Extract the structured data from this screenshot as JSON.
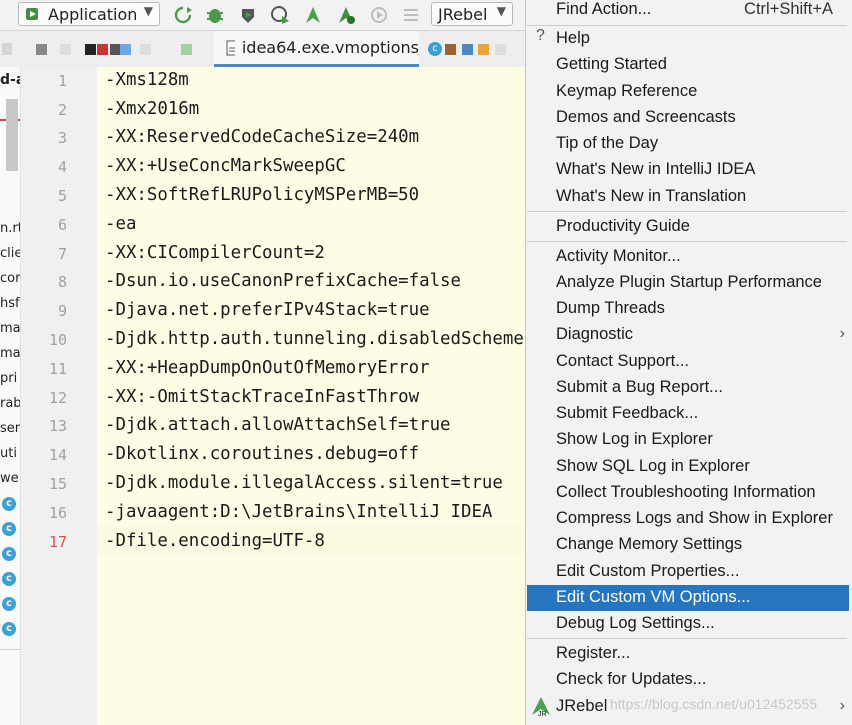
{
  "toolbar": {
    "run_config": "Application",
    "plugin": "JRebel"
  },
  "tabs": {
    "active": "idea64.exe.vmoptions"
  },
  "left_panel": {
    "fragments": [
      "d-a",
      "n.rt",
      "clie",
      "cor",
      "hsf",
      "ma",
      "ma",
      "pri",
      "rab",
      "ser",
      "uti",
      "we"
    ],
    "badge": "c"
  },
  "editor": {
    "lines": [
      {
        "num": "1",
        "text": "-Xms128m"
      },
      {
        "num": "2",
        "text": "-Xmx2016m"
      },
      {
        "num": "3",
        "text": "-XX:ReservedCodeCacheSize=240m"
      },
      {
        "num": "4",
        "text": "-XX:+UseConcMarkSweepGC"
      },
      {
        "num": "5",
        "text": "-XX:SoftRefLRUPolicyMSPerMB=50"
      },
      {
        "num": "6",
        "text": "-ea"
      },
      {
        "num": "7",
        "text": "-XX:CICompilerCount=2"
      },
      {
        "num": "8",
        "text": "-Dsun.io.useCanonPrefixCache=false"
      },
      {
        "num": "9",
        "text": "-Djava.net.preferIPv4Stack=true"
      },
      {
        "num": "10",
        "text": "-Djdk.http.auth.tunneling.disabledSchemes=\"\""
      },
      {
        "num": "11",
        "text": "-XX:+HeapDumpOnOutOfMemoryError"
      },
      {
        "num": "12",
        "text": "-XX:-OmitStackTraceInFastThrow"
      },
      {
        "num": "13",
        "text": "-Djdk.attach.allowAttachSelf=true"
      },
      {
        "num": "14",
        "text": "-Dkotlinx.coroutines.debug=off"
      },
      {
        "num": "15",
        "text": "-Djdk.module.illegalAccess.silent=true"
      },
      {
        "num": "16",
        "text": "-javaagent:D:\\JetBrains\\IntelliJ IDEA"
      },
      {
        "num": "17",
        "text": "-Dfile.encoding=UTF-8"
      }
    ]
  },
  "menu": {
    "items": [
      {
        "label": "Find Action...",
        "shortcut": "Ctrl+Shift+A"
      },
      {
        "label": "Help"
      },
      {
        "label": "Getting Started"
      },
      {
        "label": "Keymap Reference"
      },
      {
        "label": "Demos and Screencasts"
      },
      {
        "label": "Tip of the Day"
      },
      {
        "label": "What's New in IntelliJ IDEA"
      },
      {
        "label": "What's New in Translation"
      },
      {
        "label": "Productivity Guide"
      },
      {
        "label": "Activity Monitor..."
      },
      {
        "label": "Analyze Plugin Startup Performance"
      },
      {
        "label": "Dump Threads"
      },
      {
        "label": "Diagnostic"
      },
      {
        "label": "Contact Support..."
      },
      {
        "label": "Submit a Bug Report..."
      },
      {
        "label": "Submit Feedback..."
      },
      {
        "label": "Show Log in Explorer"
      },
      {
        "label": "Show SQL Log in Explorer"
      },
      {
        "label": "Collect Troubleshooting Information"
      },
      {
        "label": "Compress Logs and Show in Explorer"
      },
      {
        "label": "Change Memory Settings"
      },
      {
        "label": "Edit Custom Properties..."
      },
      {
        "label": "Edit Custom VM Options...",
        "selected": true
      },
      {
        "label": "Debug Log Settings..."
      },
      {
        "label": "Register..."
      },
      {
        "label": "Check for Updates..."
      },
      {
        "label": "JRebel"
      }
    ]
  },
  "watermark": "https://blog.csdn.net/u012452555",
  "colors": {
    "selection": "#2675bf",
    "editor_bg": "#fdfde6",
    "accent_tab": "#4a88c7"
  }
}
